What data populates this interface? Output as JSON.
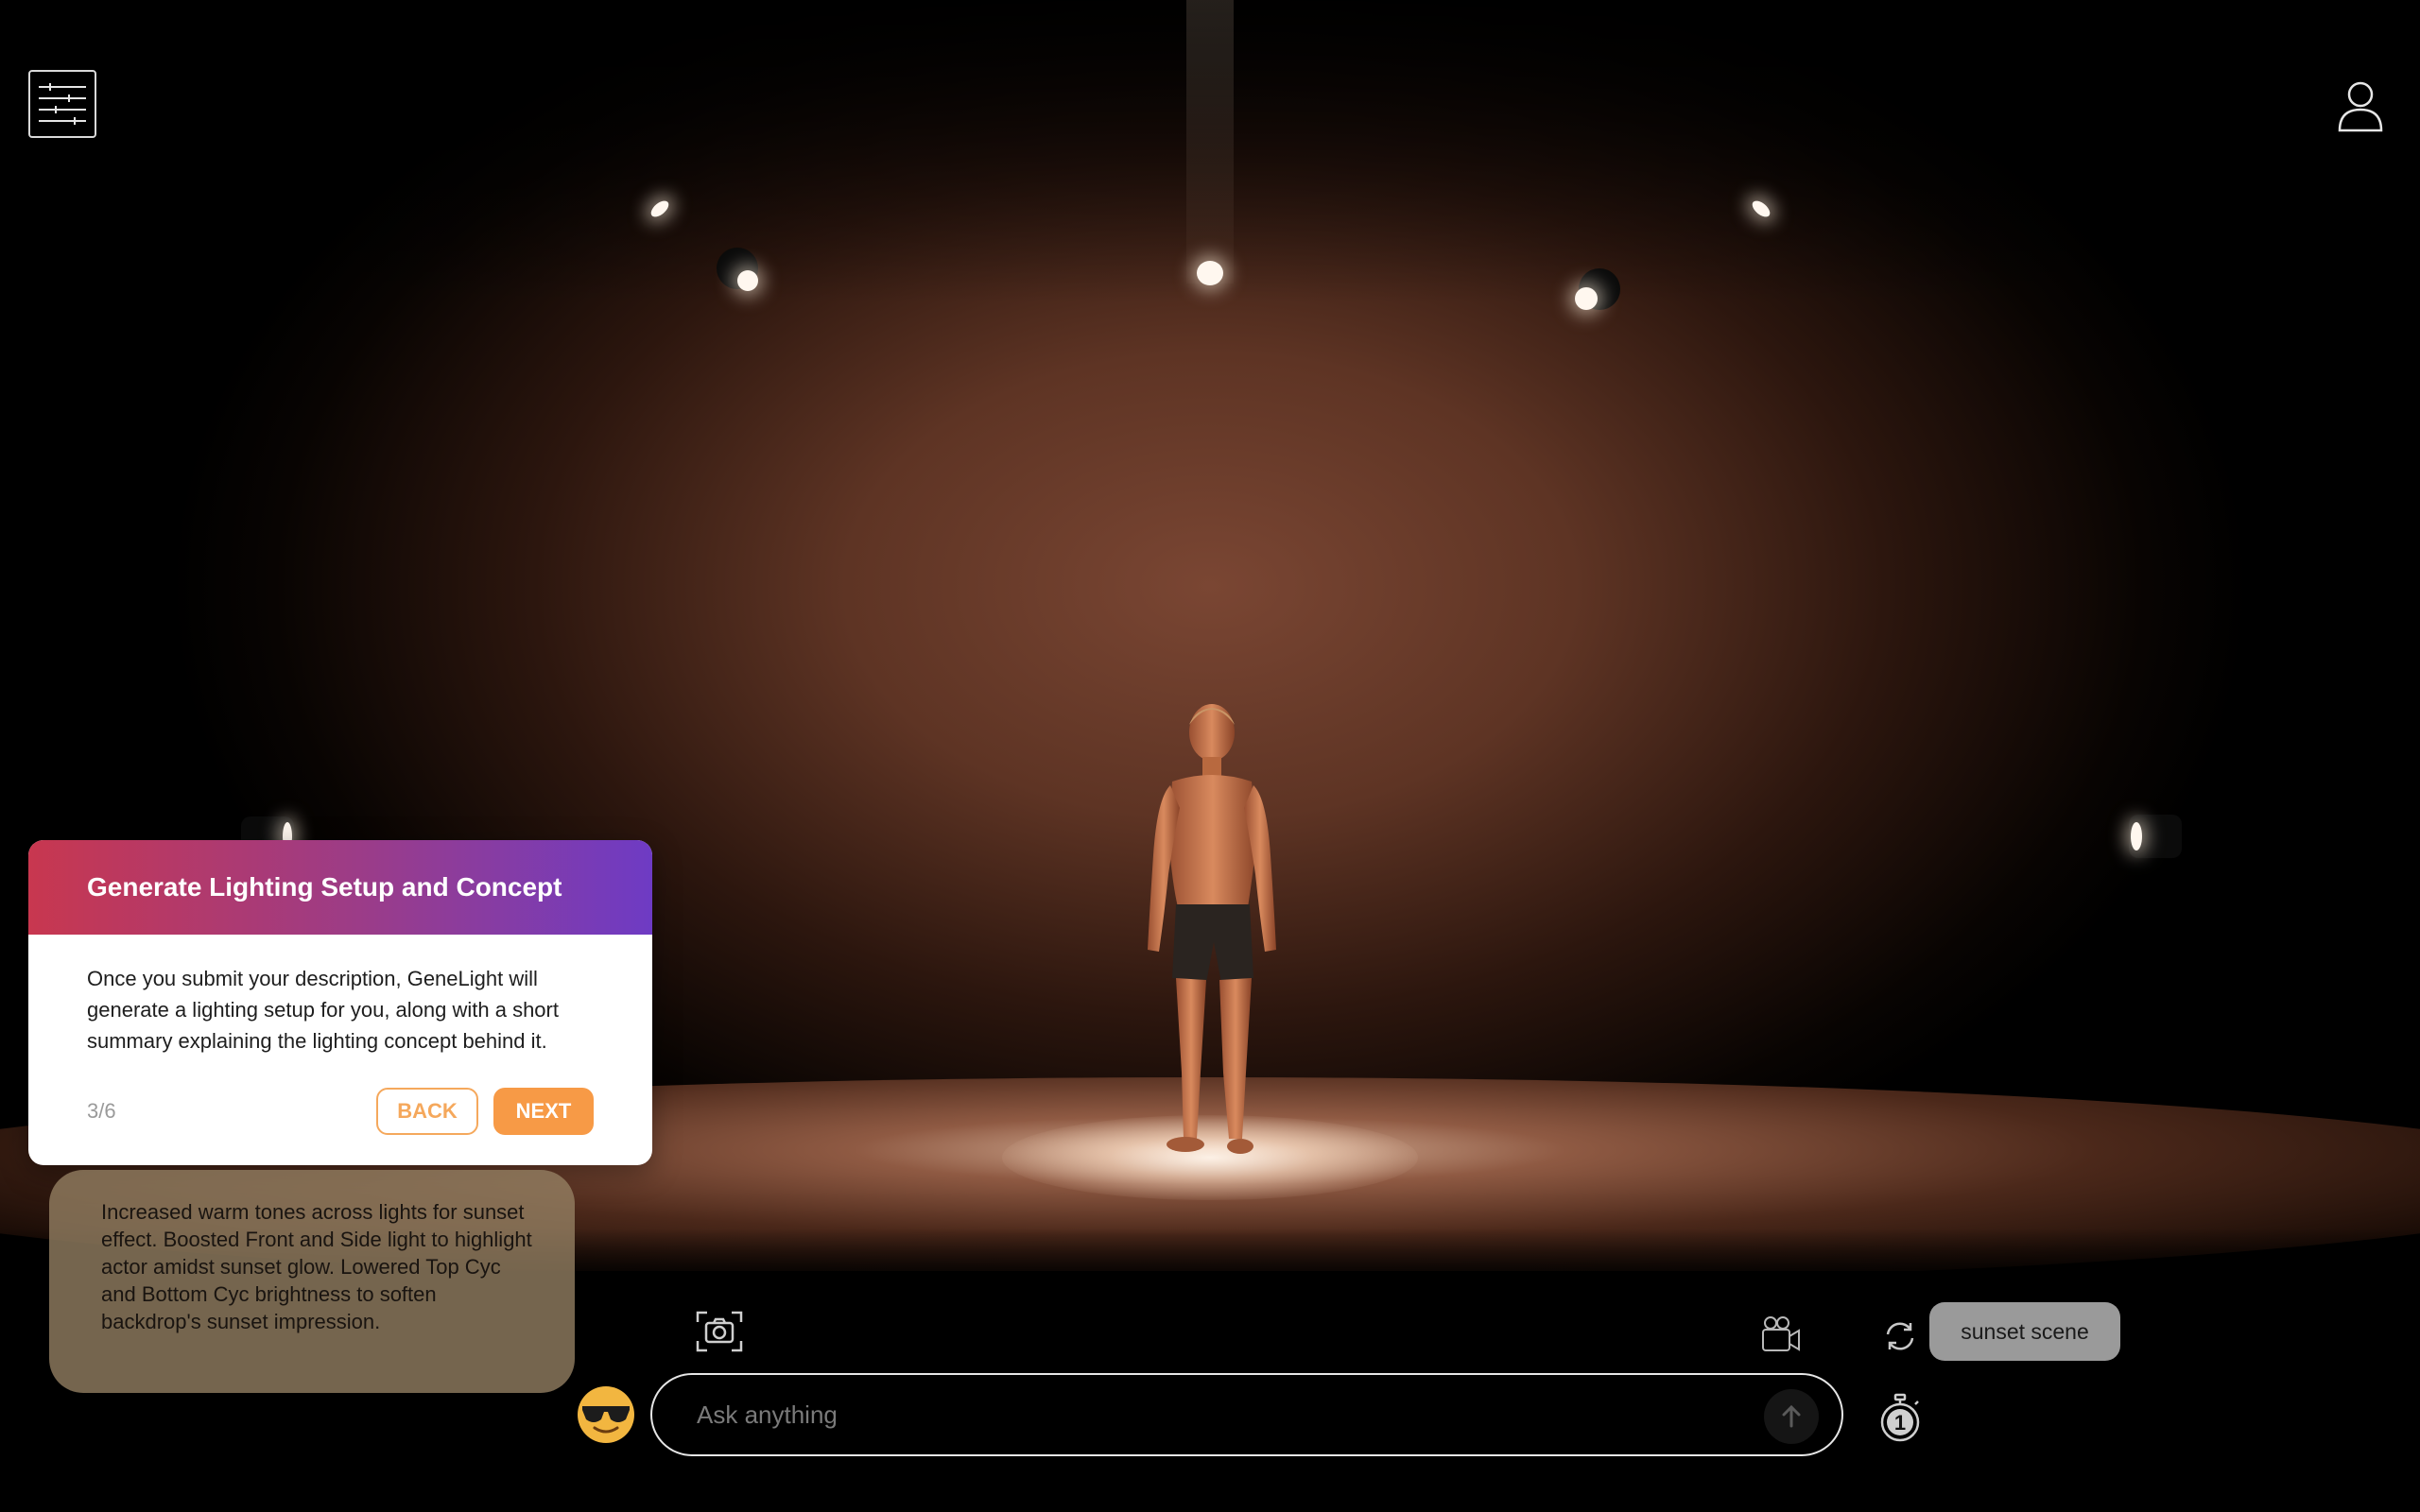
{
  "header": {
    "menu_icon": "sliders-icon",
    "user_icon": "user-icon"
  },
  "tour": {
    "title": "Generate Lighting Setup and Concept",
    "body": "Once you submit your description, GeneLight will generate a lighting setup for you, along with a short summary explaining the lighting concept behind it.",
    "step": "3/6",
    "back_label": "BACK",
    "next_label": "NEXT",
    "colors": {
      "gradient_start": "#c8374f",
      "gradient_end": "#6e3bc4",
      "accent": "#f79a46"
    }
  },
  "summary": {
    "text": "Increased warm tones across lights for sunset effect. Boosted Front and Side light to highlight actor amidst sunset glow. Lowered Top Cyc and Bottom Cyc brightness to soften backdrop's sunset impression."
  },
  "toolbar": {
    "screenshot_icon": "camera-capture-icon",
    "video_icon": "video-camera-icon",
    "refresh_icon": "refresh-icon",
    "suggestion_chip": "sunset scene",
    "timer_icon": "stopwatch-icon",
    "timer_value": "1",
    "avatar_icon": "sunglasses-emoji-icon",
    "send_icon": "arrow-up-icon"
  },
  "chat": {
    "placeholder": "Ask anything"
  }
}
